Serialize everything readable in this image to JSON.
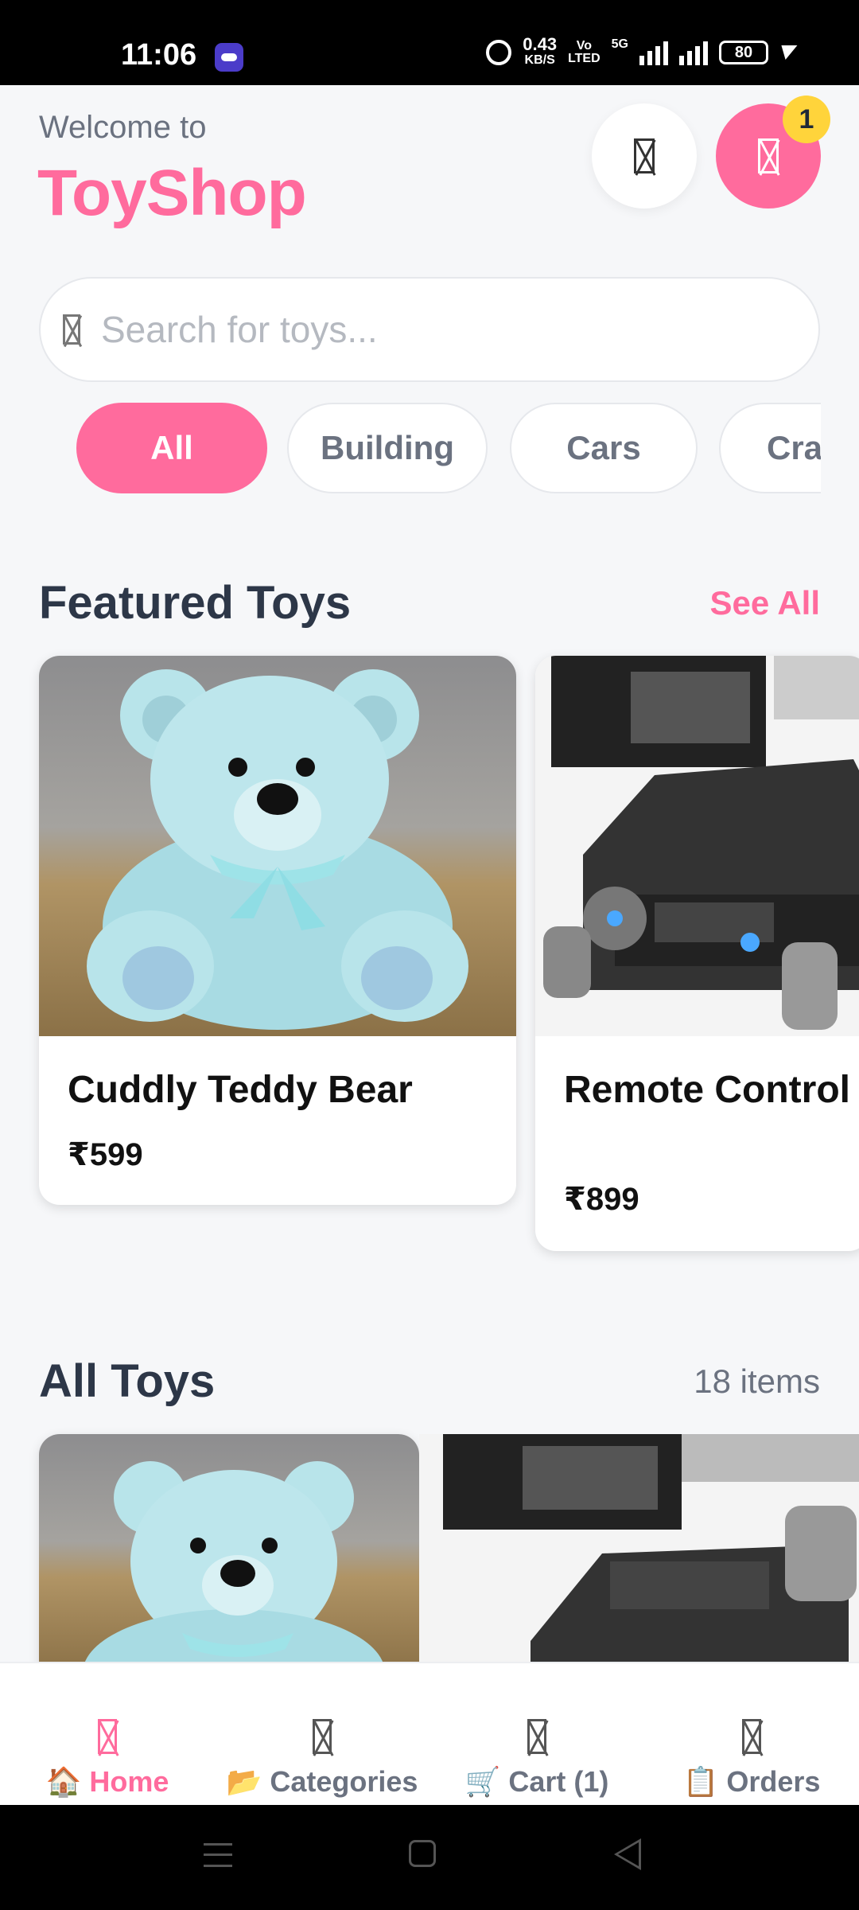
{
  "status_bar": {
    "time": "11:06",
    "speed_value": "0.43",
    "speed_unit": "KB/S",
    "volte_top": "Vo",
    "volte_bottom": "LTED",
    "network": "5G",
    "battery": "80"
  },
  "header": {
    "welcome": "Welcome to",
    "brand": "ToyShop",
    "profile_icon": "profile-icon",
    "cart_icon": "cart-icon",
    "cart_badge": "1"
  },
  "search": {
    "placeholder": "Search for toys...",
    "value": ""
  },
  "categories": [
    {
      "label": "All",
      "active": true
    },
    {
      "label": "Building",
      "active": false
    },
    {
      "label": "Cars",
      "active": false
    },
    {
      "label": "Crafts",
      "active": false
    }
  ],
  "featured": {
    "title": "Featured Toys",
    "see_all": "See All",
    "items": [
      {
        "name": "Cuddly Teddy Bear",
        "price": "₹599"
      },
      {
        "name": "Remote Control Robot Car",
        "price": "₹899"
      }
    ]
  },
  "all_toys": {
    "title": "All Toys",
    "count": "18 items"
  },
  "bottom_nav": [
    {
      "label": "🏠 Home",
      "active": true
    },
    {
      "label": "📂 Categories",
      "active": false
    },
    {
      "label": "🛒 Cart (1)",
      "active": false
    },
    {
      "label": "📋 Orders",
      "active": false
    }
  ],
  "colors": {
    "accent": "#ff6b9d",
    "badge": "#ffd43b",
    "heading": "#2d3748",
    "muted": "#6b7280",
    "background": "#f6f7f9"
  }
}
